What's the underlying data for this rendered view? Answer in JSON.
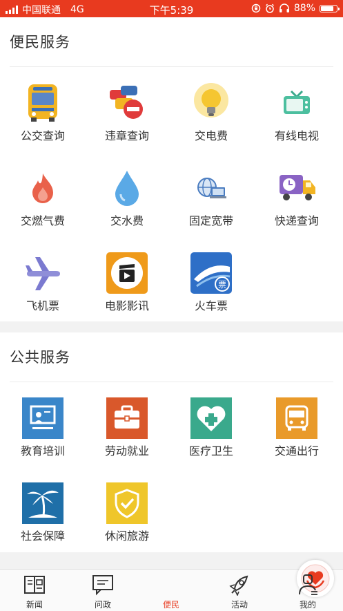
{
  "status_bar": {
    "carrier": "中国联通",
    "network": "4G",
    "time": "下午5:39",
    "battery_percent": "88%",
    "battery_level": 0.88
  },
  "colors": {
    "brand_red": "#e83a1f"
  },
  "sections": [
    {
      "title": "便民服务",
      "items": [
        {
          "label": "公交查询",
          "icon": "bus-icon"
        },
        {
          "label": "违章查询",
          "icon": "traffic-violation-icon"
        },
        {
          "label": "交电费",
          "icon": "lightbulb-icon"
        },
        {
          "label": "有线电视",
          "icon": "tv-icon"
        },
        {
          "label": "交燃气费",
          "icon": "flame-icon"
        },
        {
          "label": "交水费",
          "icon": "water-drop-icon"
        },
        {
          "label": "固定宽带",
          "icon": "broadband-icon"
        },
        {
          "label": "快递查询",
          "icon": "delivery-truck-icon"
        },
        {
          "label": "飞机票",
          "icon": "airplane-icon"
        },
        {
          "label": "电影影讯",
          "icon": "movie-clapper-icon"
        },
        {
          "label": "火车票",
          "icon": "train-ticket-icon"
        }
      ]
    },
    {
      "title": "公共服务",
      "items": [
        {
          "label": "教育培训",
          "icon": "education-icon"
        },
        {
          "label": "劳动就业",
          "icon": "briefcase-icon"
        },
        {
          "label": "医疗卫生",
          "icon": "medical-heart-icon"
        },
        {
          "label": "交通出行",
          "icon": "bus-front-icon"
        },
        {
          "label": "社会保障",
          "icon": "palm-tree-icon"
        },
        {
          "label": "休闲旅游",
          "icon": "shield-check-icon"
        }
      ]
    }
  ],
  "tabbar": {
    "tabs": [
      {
        "label": "新闻",
        "icon": "news-icon"
      },
      {
        "label": "问政",
        "icon": "inquiry-icon"
      },
      {
        "label": "便民",
        "icon": "heart-hands-icon",
        "active": true
      },
      {
        "label": "活动",
        "icon": "rocket-icon"
      },
      {
        "label": "我的",
        "icon": "user-icon"
      }
    ]
  }
}
